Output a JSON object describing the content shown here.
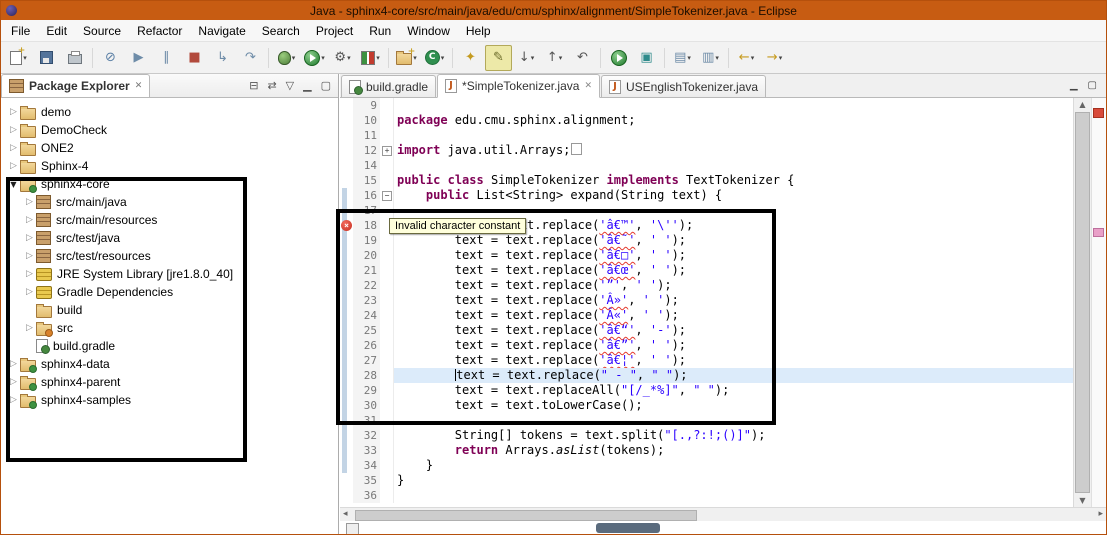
{
  "window": {
    "title": "Java - sphinx4-core/src/main/java/edu/cmu/sphinx/alignment/SimpleTokenizer.java - Eclipse"
  },
  "menu": {
    "items": [
      "File",
      "Edit",
      "Source",
      "Refactor",
      "Navigate",
      "Search",
      "Project",
      "Run",
      "Window",
      "Help"
    ]
  },
  "toolbar": {
    "icons": [
      {
        "name": "new-wizard",
        "css": "page",
        "dd": true
      },
      {
        "name": "save",
        "css": "floppy"
      },
      {
        "name": "print",
        "css": "printer"
      },
      {
        "sep": true
      },
      {
        "name": "skip-all-breakpoints",
        "glyph": "⊘",
        "color": "#5a7fa5"
      },
      {
        "name": "resume",
        "glyph": "▶",
        "color": "#6e8ca8"
      },
      {
        "name": "suspend",
        "glyph": "∥",
        "color": "#6e8ca8"
      },
      {
        "name": "terminate",
        "glyph": "■",
        "color": "#b24a3c"
      },
      {
        "name": "step-into",
        "glyph": "↳",
        "color": "#6e8ca8"
      },
      {
        "name": "step-over",
        "glyph": "↷",
        "color": "#6e8ca8"
      },
      {
        "sep": true
      },
      {
        "name": "debug",
        "css": "bug",
        "dd": true
      },
      {
        "name": "run",
        "css": "runbtn",
        "dd": true
      },
      {
        "name": "external-tools",
        "glyph": "⚙",
        "color": "#555555",
        "dd": true
      },
      {
        "name": "coverage",
        "css": "coverage",
        "dd": true
      },
      {
        "sep": true
      },
      {
        "name": "new-java-project",
        "css": "folder ic-folderplus",
        "dd": true
      },
      {
        "name": "new-java-class",
        "css": "classbtn",
        "dd": true
      },
      {
        "sep": true
      },
      {
        "name": "search-flashlight",
        "glyph": "✦",
        "color": "#c49a1f"
      },
      {
        "name": "mark-occurrences",
        "glyph": "✎",
        "color": "#6b6b2a",
        "pressed": true
      },
      {
        "name": "next-annotation",
        "glyph": "↓",
        "color": "#555555",
        "dd": true
      },
      {
        "name": "previous-annotation",
        "glyph": "↑",
        "color": "#555555",
        "dd": true
      },
      {
        "name": "last-edit-location",
        "glyph": "↶",
        "color": "#555555"
      },
      {
        "sep": true
      },
      {
        "name": "run-last-launched",
        "css": "runbtn"
      },
      {
        "name": "profile",
        "glyph": "▣",
        "color": "#2e8b8b"
      },
      {
        "sep": true
      },
      {
        "name": "open-type",
        "glyph": "▤",
        "color": "#6e8ca8",
        "dd": true
      },
      {
        "name": "open-resource",
        "glyph": "▥",
        "color": "#6e8ca8",
        "dd": true
      },
      {
        "sep": true
      },
      {
        "name": "back",
        "glyph": "←",
        "color": "#c79b1e",
        "dd": true
      },
      {
        "name": "forward",
        "glyph": "→",
        "color": "#c79b1e",
        "dd": true
      }
    ]
  },
  "package_explorer": {
    "title": "Package Explorer",
    "tree": [
      {
        "label": "demo",
        "depth": 0,
        "state": "collapsed",
        "icon": "project"
      },
      {
        "label": "DemoCheck",
        "depth": 0,
        "state": "collapsed",
        "icon": "project"
      },
      {
        "label": "ONE2",
        "depth": 0,
        "state": "collapsed",
        "icon": "project"
      },
      {
        "label": "Sphinx-4",
        "depth": 0,
        "state": "collapsed",
        "icon": "project"
      },
      {
        "label": "sphinx4-core",
        "depth": 0,
        "state": "expanded",
        "icon": "project-gradle"
      },
      {
        "label": "src/main/java",
        "depth": 1,
        "state": "collapsed",
        "icon": "srcfolder"
      },
      {
        "label": "src/main/resources",
        "depth": 1,
        "state": "collapsed",
        "icon": "srcfolder"
      },
      {
        "label": "src/test/java",
        "depth": 1,
        "state": "collapsed",
        "icon": "srcfolder"
      },
      {
        "label": "src/test/resources",
        "depth": 1,
        "state": "collapsed",
        "icon": "srcfolder"
      },
      {
        "label": "JRE System Library [jre1.8.0_40]",
        "depth": 1,
        "state": "collapsed",
        "icon": "library"
      },
      {
        "label": "Gradle Dependencies",
        "depth": 1,
        "state": "collapsed",
        "icon": "library"
      },
      {
        "label": "build",
        "depth": 1,
        "state": "leaf",
        "icon": "folder"
      },
      {
        "label": "src",
        "depth": 1,
        "state": "collapsed",
        "icon": "folder-src"
      },
      {
        "label": "build.gradle",
        "depth": 1,
        "state": "leaf",
        "icon": "gradle-file"
      },
      {
        "label": "sphinx4-data",
        "depth": 0,
        "state": "collapsed",
        "icon": "project-gradle"
      },
      {
        "label": "sphinx4-parent",
        "depth": 0,
        "state": "collapsed",
        "icon": "project-gradle"
      },
      {
        "label": "sphinx4-samples",
        "depth": 0,
        "state": "collapsed",
        "icon": "project-gradle"
      }
    ]
  },
  "editor": {
    "tabs": [
      {
        "label": "build.gradle",
        "icon": "gradle",
        "active": false
      },
      {
        "label": "*SimpleTokenizer.java",
        "icon": "java",
        "active": true
      },
      {
        "label": "USEnglishTokenizer.java",
        "icon": "java",
        "active": false
      }
    ],
    "tooltip": "Invalid character constant",
    "lines": [
      {
        "n": "9",
        "seg": []
      },
      {
        "n": "10",
        "seg": [
          [
            "kw",
            "package"
          ],
          [
            "pl",
            " edu.cmu.sphinx.alignment;"
          ]
        ]
      },
      {
        "n": "11",
        "seg": []
      },
      {
        "n": "12",
        "fold": "+",
        "seg": [
          [
            "kw",
            "import"
          ],
          [
            "pl",
            " java.util.Arrays;"
          ],
          [
            "box",
            ""
          ]
        ]
      },
      {
        "n": "14",
        "seg": []
      },
      {
        "n": "15",
        "seg": [
          [
            "kw",
            "public"
          ],
          [
            "pl",
            " "
          ],
          [
            "kw",
            "class"
          ],
          [
            "pl",
            " SimpleTokenizer "
          ],
          [
            "kw",
            "implements"
          ],
          [
            "pl",
            " TextTokenizer {"
          ]
        ]
      },
      {
        "n": "16",
        "fold": "-",
        "seg": [
          [
            "pl",
            "    "
          ],
          [
            "kw",
            "public"
          ],
          [
            "pl",
            " List<String> expand(String text) {"
          ]
        ]
      },
      {
        "n": "17",
        "seg": []
      },
      {
        "n": "18",
        "err": true,
        "seg": [
          [
            "pl",
            "        text = text.replace("
          ],
          [
            "strerr",
            "'â€™'"
          ],
          [
            "pl",
            ", "
          ],
          [
            "str",
            "'\\''"
          ],
          [
            "pl",
            ");"
          ]
        ]
      },
      {
        "n": "19",
        "seg": [
          [
            "pl",
            "        text = text.replace("
          ],
          [
            "strerr",
            "'â€˜'"
          ],
          [
            "pl",
            ", "
          ],
          [
            "str",
            "' '"
          ],
          [
            "pl",
            ");"
          ]
        ]
      },
      {
        "n": "20",
        "seg": [
          [
            "pl",
            "        text = text.replace("
          ],
          [
            "strerr",
            "'â€□'"
          ],
          [
            "pl",
            ", "
          ],
          [
            "str",
            "' '"
          ],
          [
            "pl",
            ");"
          ]
        ]
      },
      {
        "n": "21",
        "seg": [
          [
            "pl",
            "        text = text.replace("
          ],
          [
            "strerr",
            "'â€œ'"
          ],
          [
            "pl",
            ", "
          ],
          [
            "str",
            "' '"
          ],
          [
            "pl",
            ");"
          ]
        ]
      },
      {
        "n": "22",
        "seg": [
          [
            "pl",
            "        text = text.replace("
          ],
          [
            "str",
            "'”'"
          ],
          [
            "pl",
            ", "
          ],
          [
            "str",
            "' '"
          ],
          [
            "pl",
            ");"
          ]
        ]
      },
      {
        "n": "23",
        "seg": [
          [
            "pl",
            "        text = text.replace("
          ],
          [
            "strerr",
            "'Â»'"
          ],
          [
            "pl",
            ", "
          ],
          [
            "str",
            "' '"
          ],
          [
            "pl",
            ");"
          ]
        ]
      },
      {
        "n": "24",
        "seg": [
          [
            "pl",
            "        text = text.replace("
          ],
          [
            "strerr",
            "'Â«'"
          ],
          [
            "pl",
            ", "
          ],
          [
            "str",
            "' '"
          ],
          [
            "pl",
            ");"
          ]
        ]
      },
      {
        "n": "25",
        "seg": [
          [
            "pl",
            "        text = text.replace("
          ],
          [
            "strerr",
            "'â€“'"
          ],
          [
            "pl",
            ", "
          ],
          [
            "str",
            "'-'"
          ],
          [
            "pl",
            ");"
          ]
        ]
      },
      {
        "n": "26",
        "seg": [
          [
            "pl",
            "        text = text.replace("
          ],
          [
            "strerr",
            "'â€”'"
          ],
          [
            "pl",
            ", "
          ],
          [
            "str",
            "' '"
          ],
          [
            "pl",
            ");"
          ]
        ]
      },
      {
        "n": "27",
        "seg": [
          [
            "pl",
            "        text = text.replace("
          ],
          [
            "strerr",
            "'â€¦'"
          ],
          [
            "pl",
            ", "
          ],
          [
            "str",
            "' '"
          ],
          [
            "pl",
            ");"
          ]
        ]
      },
      {
        "n": "28",
        "cur": true,
        "seg": [
          [
            "pl",
            "        "
          ],
          [
            "cursor",
            ""
          ],
          [
            "pl",
            "text = text.replace("
          ],
          [
            "str",
            "\" - \""
          ],
          [
            "pl",
            ", "
          ],
          [
            "str",
            "\" \""
          ],
          [
            "pl",
            ");"
          ]
        ]
      },
      {
        "n": "29",
        "seg": [
          [
            "pl",
            "        text = text.replaceAll("
          ],
          [
            "str",
            "\"[/_*%]\""
          ],
          [
            "pl",
            ", "
          ],
          [
            "str",
            "\" \""
          ],
          [
            "pl",
            ");"
          ]
        ]
      },
      {
        "n": "30",
        "seg": [
          [
            "pl",
            "        text = text.toLowerCase();"
          ]
        ]
      },
      {
        "n": "31",
        "seg": []
      },
      {
        "n": "32",
        "seg": [
          [
            "pl",
            "        String[] tokens = text.split("
          ],
          [
            "str",
            "\"[.,?:!;()]\""
          ],
          [
            "pl",
            ");"
          ]
        ]
      },
      {
        "n": "33",
        "seg": [
          [
            "pl",
            "        "
          ],
          [
            "kw",
            "return"
          ],
          [
            "pl",
            " Arrays."
          ],
          [
            "it",
            "asList"
          ],
          [
            "pl",
            "(tokens);"
          ]
        ]
      },
      {
        "n": "34",
        "seg": [
          [
            "pl",
            "    }"
          ]
        ]
      },
      {
        "n": "35",
        "seg": [
          [
            "pl",
            "}"
          ]
        ]
      },
      {
        "n": "36",
        "seg": []
      }
    ]
  }
}
